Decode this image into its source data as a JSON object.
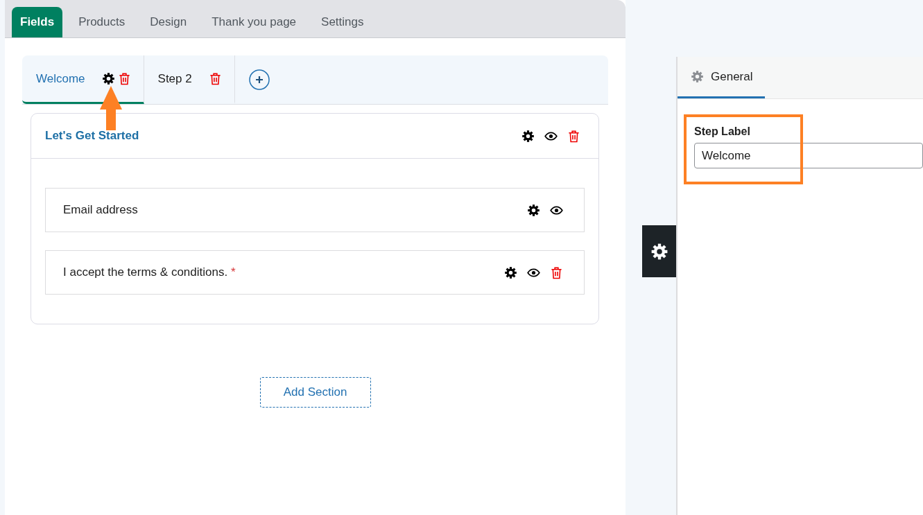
{
  "main_tabs": [
    {
      "label": "Fields",
      "selected": true
    },
    {
      "label": "Products",
      "selected": false
    },
    {
      "label": "Design",
      "selected": false
    },
    {
      "label": "Thank you page",
      "selected": false
    },
    {
      "label": "Settings",
      "selected": false
    }
  ],
  "steps": [
    {
      "label": "Welcome",
      "selected": true
    },
    {
      "label": "Step 2",
      "selected": false
    }
  ],
  "section": {
    "title": "Let's Get Started",
    "fields": [
      {
        "label": "Email address",
        "deletable": false
      },
      {
        "label": "I accept the terms & conditions.",
        "required_mark": "*",
        "deletable": true
      }
    ]
  },
  "add_section_button": "Add Section",
  "settings_panel": {
    "tabs": [
      {
        "label": "General",
        "selected": true
      }
    ],
    "fields": [
      {
        "label": "Step Label",
        "value": "Welcome"
      }
    ]
  }
}
